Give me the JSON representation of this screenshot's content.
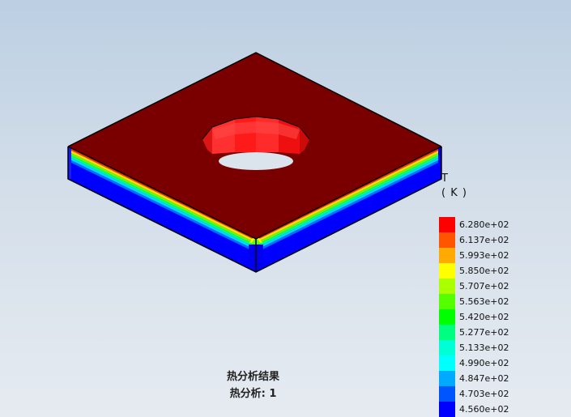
{
  "result_plot": {
    "quantity_symbol": "T",
    "unit": "( K )",
    "colormap": [
      {
        "value": "6.280e+02",
        "color": "#ff0000"
      },
      {
        "value": "6.137e+02",
        "color": "#ff5500"
      },
      {
        "value": "5.993e+02",
        "color": "#ffaa00"
      },
      {
        "value": "5.850e+02",
        "color": "#ffff00"
      },
      {
        "value": "5.707e+02",
        "color": "#aaff00"
      },
      {
        "value": "5.563e+02",
        "color": "#55ff00"
      },
      {
        "value": "5.420e+02",
        "color": "#00ff00"
      },
      {
        "value": "5.277e+02",
        "color": "#00ff80"
      },
      {
        "value": "5.133e+02",
        "color": "#00ffd5"
      },
      {
        "value": "4.990e+02",
        "color": "#00ffff"
      },
      {
        "value": "4.847e+02",
        "color": "#00aaff"
      },
      {
        "value": "4.703e+02",
        "color": "#0055ff"
      },
      {
        "value": "4.560e+02",
        "color": "#0000ff"
      }
    ],
    "title": "热分析结果",
    "subtitle": "热分析: 1"
  },
  "colors": {
    "background_top": "#bccfe3",
    "background_bottom": "#e6ebf1",
    "plate_top": "#7a0000",
    "hole_wall": "#ff2222",
    "side_cold": "#0000ff",
    "edge_line": "#000000"
  }
}
